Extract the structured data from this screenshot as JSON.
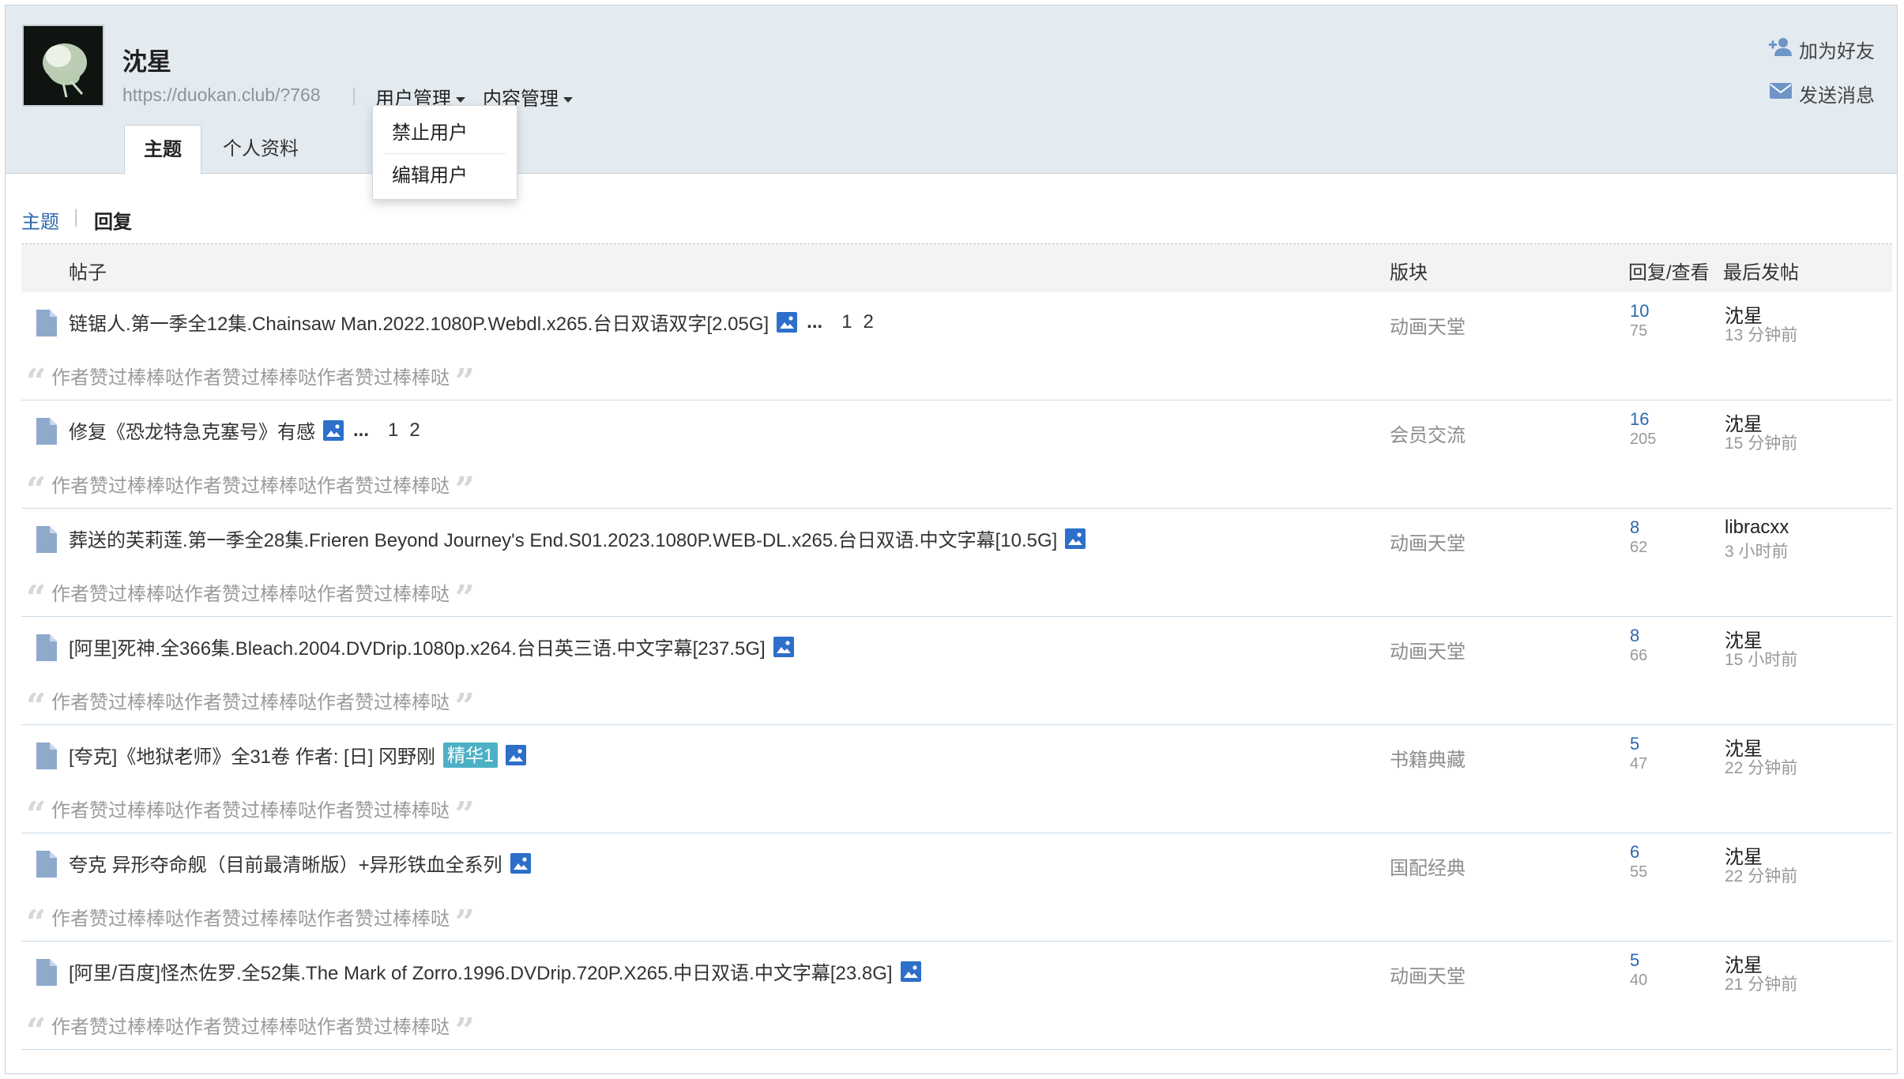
{
  "profile": {
    "username": "沈星",
    "url": "https://duokan.club/?768",
    "separator": "|",
    "menus": [
      {
        "label": "用户管理"
      },
      {
        "label": "内容管理"
      }
    ],
    "dropdown": [
      {
        "label": "禁止用户"
      },
      {
        "label": "编辑用户"
      }
    ],
    "tabs": [
      {
        "label": "主题",
        "active": true
      },
      {
        "label": "个人资料",
        "active": false
      }
    ],
    "actions": {
      "add_friend": "加为好友",
      "send_message": "发送消息"
    }
  },
  "subnav": {
    "link": "主题",
    "separator": "|",
    "current": "回复"
  },
  "table": {
    "headers": {
      "post": "帖子",
      "forum": "版块",
      "stats": "回复/查看",
      "last": "最后发帖"
    },
    "rows": [
      {
        "title": "链锯人.第一季全12集.Chainsaw Man.2022.1080P.Webdl.x265.台日双语双字[2.05G]",
        "has_image": true,
        "ellipsis": "...",
        "pages": [
          "1",
          "2"
        ],
        "badge": "",
        "quote": "作者赞过棒棒哒作者赞过棒棒哒作者赞过棒棒哒",
        "forum": "动画天堂",
        "replies": "10",
        "views": "75",
        "last_user": "沈星",
        "last_time": "13 分钟前"
      },
      {
        "title": "修复《恐龙特急克塞号》有感",
        "has_image": true,
        "ellipsis": "...",
        "pages": [
          "1",
          "2"
        ],
        "badge": "",
        "quote": "作者赞过棒棒哒作者赞过棒棒哒作者赞过棒棒哒",
        "forum": "会员交流",
        "replies": "16",
        "views": "205",
        "last_user": "沈星",
        "last_time": "15 分钟前"
      },
      {
        "title": "葬送的芙莉莲.第一季全28集.Frieren Beyond Journey's End.S01.2023.1080P.WEB-DL.x265.台日双语.中文字幕[10.5G]",
        "has_image": true,
        "ellipsis": "",
        "pages": [],
        "badge": "",
        "quote": "作者赞过棒棒哒作者赞过棒棒哒作者赞过棒棒哒",
        "forum": "动画天堂",
        "replies": "8",
        "views": "62",
        "last_user": "libracxx",
        "last_time": "3 小时前"
      },
      {
        "title": "[阿里]死神.全366集.Bleach.2004.DVDrip.1080p.x264.台日英三语.中文字幕[237.5G]",
        "has_image": true,
        "ellipsis": "",
        "pages": [],
        "badge": "",
        "quote": "作者赞过棒棒哒作者赞过棒棒哒作者赞过棒棒哒",
        "forum": "动画天堂",
        "replies": "8",
        "views": "66",
        "last_user": "沈星",
        "last_time": "15 小时前"
      },
      {
        "title": "[夸克]《地狱老师》全31卷 作者: [日] 冈野刚",
        "has_image": true,
        "ellipsis": "",
        "pages": [],
        "badge": "精华1",
        "quote": "作者赞过棒棒哒作者赞过棒棒哒作者赞过棒棒哒",
        "forum": "书籍典藏",
        "replies": "5",
        "views": "47",
        "last_user": "沈星",
        "last_time": "22 分钟前"
      },
      {
        "title": "夸克 异形夺命舰（目前最清晰版）+异形铁血全系列",
        "has_image": true,
        "ellipsis": "",
        "pages": [],
        "badge": "",
        "quote": "作者赞过棒棒哒作者赞过棒棒哒作者赞过棒棒哒",
        "forum": "国配经典",
        "replies": "6",
        "views": "55",
        "last_user": "沈星",
        "last_time": "22 分钟前"
      },
      {
        "title": "[阿里/百度]怪杰佐罗.全52集.The Mark of Zorro.1996.DVDrip.720P.X265.中日双语.中文字幕[23.8G]",
        "has_image": true,
        "ellipsis": "",
        "pages": [],
        "badge": "",
        "quote": "作者赞过棒棒哒作者赞过棒棒哒作者赞过棒棒哒",
        "forum": "动画天堂",
        "replies": "5",
        "views": "40",
        "last_user": "沈星",
        "last_time": "21 分钟前"
      }
    ]
  },
  "icons": {
    "add_friend": "user-plus-icon",
    "send_message": "envelope-icon",
    "document": "document-icon",
    "image": "image-icon",
    "quote_open": "quote-open-icon",
    "quote_close": "quote-close-icon"
  },
  "colors": {
    "header_bg": "#e4ebf0",
    "link_blue": "#2c67ad",
    "icon_blue": "#2d6fc9",
    "doc_icon": "#8fa9cd",
    "badge_bg": "#4db0c5",
    "row_border": "#c9dae8"
  }
}
